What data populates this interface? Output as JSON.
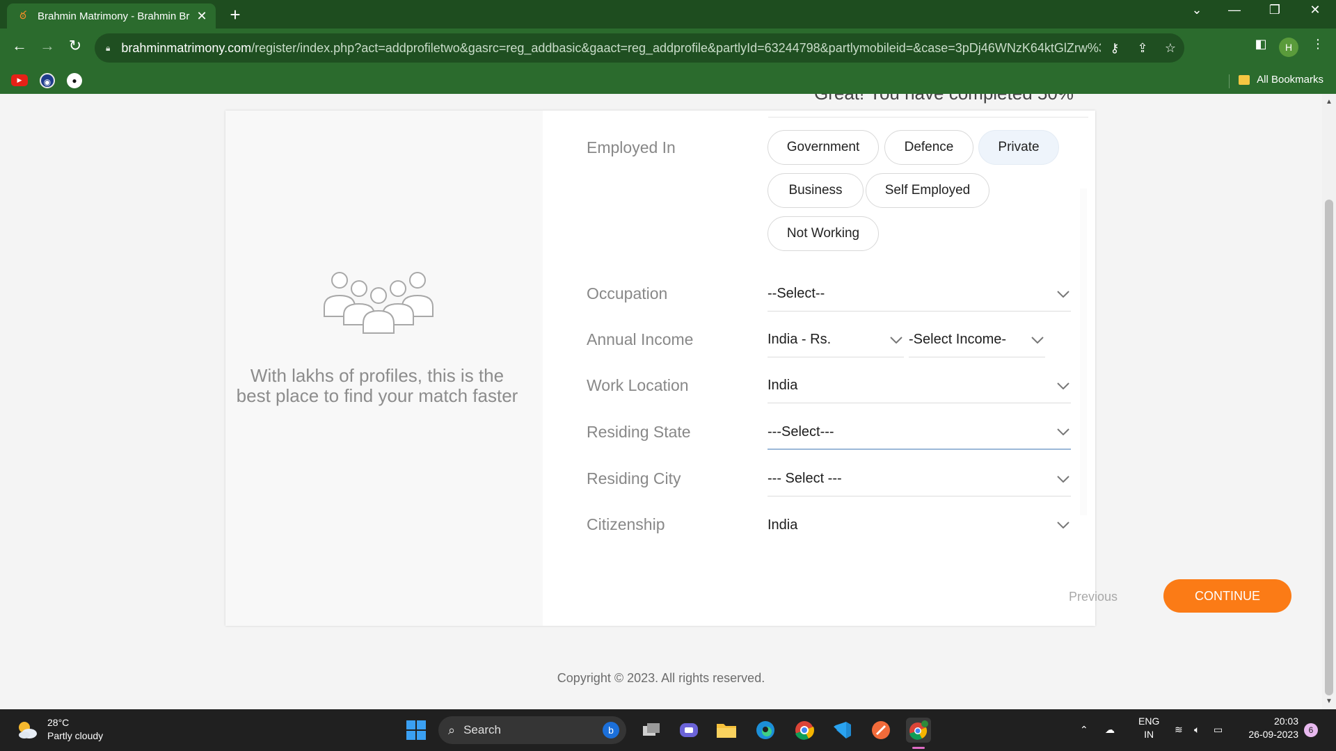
{
  "browser": {
    "tab_title": "Brahmin Matrimony - Brahmin Br",
    "tab_close": "✕",
    "new_tab": "+",
    "url_host": "brahminmatrimony.com",
    "url_path": "/register/index.php?act=addprofiletwo&gasrc=reg_addbasic&gaact=reg_addprofile&partlyId=63244798&partlymobileid=&case=3pDj46WNzK64ktGlZrw%3D&trck_c...",
    "profile_initial": "H",
    "all_bookmarks": "All Bookmarks"
  },
  "page": {
    "left_text_line1": "With lakhs of profiles, this is the",
    "left_text_line2": "best place to find your match faster",
    "progress_peek": "Great! You have completed 50%",
    "employed_in": {
      "label": "Employed In",
      "options": [
        "Government",
        "Defence",
        "Private",
        "Business",
        "Self Employed",
        "Not Working"
      ],
      "selected": "Private"
    },
    "occupation": {
      "label": "Occupation",
      "value": "--Select--"
    },
    "annual_income": {
      "label": "Annual Income",
      "currency": "India - Rs.",
      "income": "-Select Income-"
    },
    "work_location": {
      "label": "Work Location",
      "value": "India"
    },
    "residing_state": {
      "label": "Residing State",
      "value": "---Select---"
    },
    "residing_city": {
      "label": "Residing City",
      "value": "--- Select ---"
    },
    "citizenship": {
      "label": "Citizenship",
      "value": "India"
    },
    "previous_label": "Previous",
    "continue_label": "CONTINUE",
    "copyright": "Copyright © 2023. All rights reserved."
  },
  "taskbar": {
    "temperature": "28°C",
    "weather": "Partly cloudy",
    "search_label": "Search",
    "lang_line1": "ENG",
    "lang_line2": "IN",
    "time": "20:03",
    "date": "26-09-2023",
    "notification_count": "6"
  },
  "colors": {
    "chrome_dark": "#1e4d1f",
    "chrome": "#2b6b2d",
    "accent": "#fb7b16",
    "selected_pill": "#eef4fb"
  }
}
